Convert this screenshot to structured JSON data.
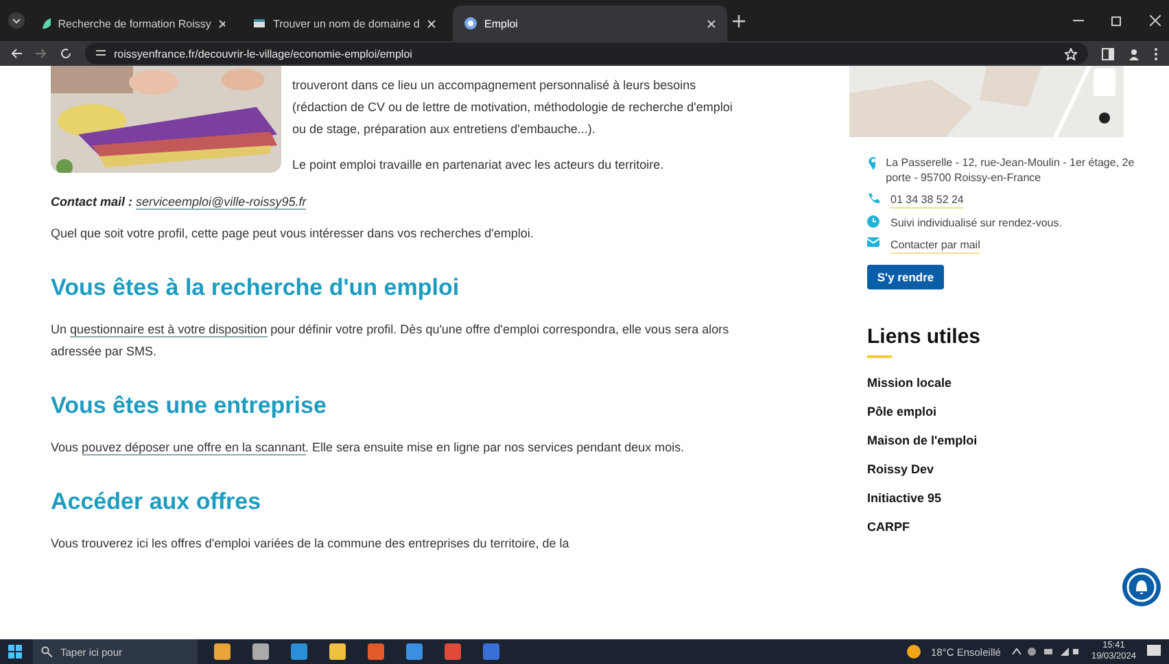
{
  "browser": {
    "tabs": [
      {
        "title": "Recherche de formation Roissy",
        "selected": false,
        "kind": "leaf"
      },
      {
        "title": "Trouver un nom de domaine d",
        "selected": false,
        "kind": "domain"
      },
      {
        "title": "Emploi",
        "selected": true,
        "kind": "site"
      }
    ],
    "url": "roissyenfrance.fr/decouvrir-le-village/economie-emploi/emploi"
  },
  "article": {
    "intro": "trouveront dans ce lieu un accompagnement personnalisé à leurs besoins (rédaction de CV ou de lettre de motivation, méthodologie de recherche d'emploi ou de stage, préparation aux entretiens d'embauche...).",
    "partner": "Le point emploi travaille en partenariat avec les acteurs du territoire.",
    "contact_label": "Contact mail :",
    "contact_email": "serviceemploi@ville-roissy95.fr",
    "profile": "Quel que soit votre profil, cette page peut vous intéresser dans vos recherches d'emploi.",
    "sections": [
      {
        "heading": "Vous êtes à la recherche d'un emploi",
        "before": "Un",
        "link": "questionnaire est à votre disposition",
        "after": "pour définir votre profil. Dès qu'une offre d'emploi correspondra, elle vous sera alors adressée par SMS."
      },
      {
        "heading": "Vous êtes une entreprise",
        "before": "Vous",
        "link": "pouvez déposer une offre en la scannant",
        "after": ". Elle sera ensuite mise en ligne par nos services pendant deux mois."
      },
      {
        "heading": "Accéder aux offres",
        "text": "Vous trouverez ici les offres d'emploi variées de la commune des entreprises du territoire, de la"
      }
    ]
  },
  "sidebar": {
    "contacts": [
      {
        "kind": "location",
        "text": "La Passerelle - 12, rue-Jean-Moulin - 1er étage, 2e porte - 95700 Roissy-en-France",
        "link": false
      },
      {
        "kind": "phone",
        "text": "01 34 38 52 24",
        "link": true
      },
      {
        "kind": "clock",
        "text": "Suivi individualisé sur rendez-vous.",
        "link": false
      },
      {
        "kind": "mail",
        "text": "Contacter par mail",
        "link": true
      }
    ],
    "button": "S'y rendre",
    "links_title": "Liens utiles",
    "links": [
      "Mission locale",
      "Pôle emploi",
      "Maison de l'emploi",
      "Roissy Dev",
      "Initiactive 95",
      "CARPF"
    ]
  },
  "taskbar": {
    "search_placeholder": "Taper ici pour",
    "weather": "18°C Ensoleillé",
    "time": "15:41",
    "date": "19/03/2024"
  }
}
